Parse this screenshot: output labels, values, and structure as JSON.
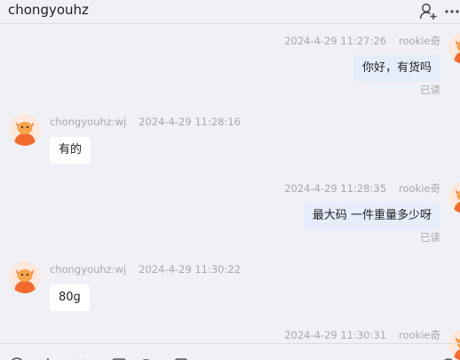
{
  "header": {
    "title": "chongyouhz",
    "icons": [
      "add-member-icon",
      "more-icon"
    ]
  },
  "messages": [
    {
      "direction": "out",
      "sender": "rookie奇",
      "time": "2024-4-29 11:27:26",
      "text": "你好，有货吗",
      "status": "已读"
    },
    {
      "direction": "in",
      "sender": "chongyouhz:wj",
      "time": "2024-4-29 11:28:16",
      "text": "有的"
    },
    {
      "direction": "out",
      "sender": "rookie奇",
      "time": "2024-4-29 11:28:35",
      "text": "最大码  一件重量多少呀",
      "status": "已读"
    },
    {
      "direction": "in",
      "sender": "chongyouhz:wj",
      "time": "2024-4-29 11:30:22",
      "text": "80g"
    },
    {
      "direction": "out",
      "sender": "rookie奇",
      "time": "2024-4-29 11:30:31"
    }
  ],
  "toolbar": {
    "icons": [
      "emoji-icon",
      "bell-icon",
      "scissors-icon",
      "image-icon",
      "folder-icon",
      "chat-icon",
      "plus-icon"
    ]
  }
}
